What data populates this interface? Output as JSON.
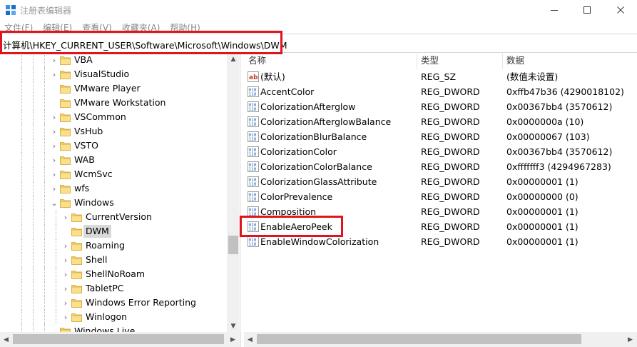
{
  "window": {
    "title": "注册表编辑器",
    "min_glyph": "—",
    "max_glyph": "☐",
    "close_glyph": "✕"
  },
  "menu": [
    "文件(F)",
    "编辑(E)",
    "查看(V)",
    "收藏夹(A)",
    "帮助(H)"
  ],
  "address": "计算机\\HKEY_CURRENT_USER\\Software\\Microsoft\\Windows\\DWM",
  "tree": {
    "items": [
      {
        "label": "VBA",
        "level": 0,
        "expander": "collapsed"
      },
      {
        "label": "VisualStudio",
        "level": 0,
        "expander": "collapsed"
      },
      {
        "label": "VMware Player",
        "level": 0,
        "expander": "none"
      },
      {
        "label": "VMware Workstation",
        "level": 0,
        "expander": "none"
      },
      {
        "label": "VSCommon",
        "level": 0,
        "expander": "collapsed"
      },
      {
        "label": "VsHub",
        "level": 0,
        "expander": "collapsed"
      },
      {
        "label": "VSTO",
        "level": 0,
        "expander": "collapsed"
      },
      {
        "label": "WAB",
        "level": 0,
        "expander": "collapsed"
      },
      {
        "label": "WcmSvc",
        "level": 0,
        "expander": "collapsed"
      },
      {
        "label": "wfs",
        "level": 0,
        "expander": "collapsed"
      },
      {
        "label": "Windows",
        "level": 0,
        "expander": "expanded"
      },
      {
        "label": "CurrentVersion",
        "level": 1,
        "expander": "collapsed"
      },
      {
        "label": "DWM",
        "level": 1,
        "expander": "none",
        "selected": true
      },
      {
        "label": "Roaming",
        "level": 1,
        "expander": "collapsed"
      },
      {
        "label": "Shell",
        "level": 1,
        "expander": "collapsed"
      },
      {
        "label": "ShellNoRoam",
        "level": 1,
        "expander": "collapsed"
      },
      {
        "label": "TabletPC",
        "level": 1,
        "expander": "collapsed"
      },
      {
        "label": "Windows Error Reporting",
        "level": 1,
        "expander": "collapsed"
      },
      {
        "label": "Winlogon",
        "level": 1,
        "expander": "collapsed"
      },
      {
        "label": "Windows Live",
        "level": 0,
        "expander": "none"
      }
    ]
  },
  "list": {
    "columns": {
      "name": "名称",
      "type": "类型",
      "data": "数据"
    },
    "rows": [
      {
        "name": "(默认)",
        "type": "REG_SZ",
        "data": "(数值未设置)",
        "icon": "string-value-icon"
      },
      {
        "name": "AccentColor",
        "type": "REG_DWORD",
        "data": "0xffb47b36 (4290018102)",
        "icon": "binary-value-icon"
      },
      {
        "name": "ColorizationAfterglow",
        "type": "REG_DWORD",
        "data": "0x00367bb4 (3570612)",
        "icon": "binary-value-icon"
      },
      {
        "name": "ColorizationAfterglowBalance",
        "type": "REG_DWORD",
        "data": "0x0000000a (10)",
        "icon": "binary-value-icon"
      },
      {
        "name": "ColorizationBlurBalance",
        "type": "REG_DWORD",
        "data": "0x00000067 (103)",
        "icon": "binary-value-icon"
      },
      {
        "name": "ColorizationColor",
        "type": "REG_DWORD",
        "data": "0x00367bb4 (3570612)",
        "icon": "binary-value-icon"
      },
      {
        "name": "ColorizationColorBalance",
        "type": "REG_DWORD",
        "data": "0xfffffff3 (4294967283)",
        "icon": "binary-value-icon"
      },
      {
        "name": "ColorizationGlassAttribute",
        "type": "REG_DWORD",
        "data": "0x00000001 (1)",
        "icon": "binary-value-icon"
      },
      {
        "name": "ColorPrevalence",
        "type": "REG_DWORD",
        "data": "0x00000000 (0)",
        "icon": "binary-value-icon"
      },
      {
        "name": "Composition",
        "type": "REG_DWORD",
        "data": "0x00000001 (1)",
        "icon": "binary-value-icon"
      },
      {
        "name": "EnableAeroPeek",
        "type": "REG_DWORD",
        "data": "0x00000001 (1)",
        "icon": "binary-value-icon"
      },
      {
        "name": "EnableWindowColorization",
        "type": "REG_DWORD",
        "data": "0x00000001 (1)",
        "icon": "binary-value-icon"
      }
    ]
  },
  "colors": {
    "highlight_red": "#e0141e",
    "folder_yellow": "#f5d46a",
    "selection_gray": "#d9d9d9"
  }
}
